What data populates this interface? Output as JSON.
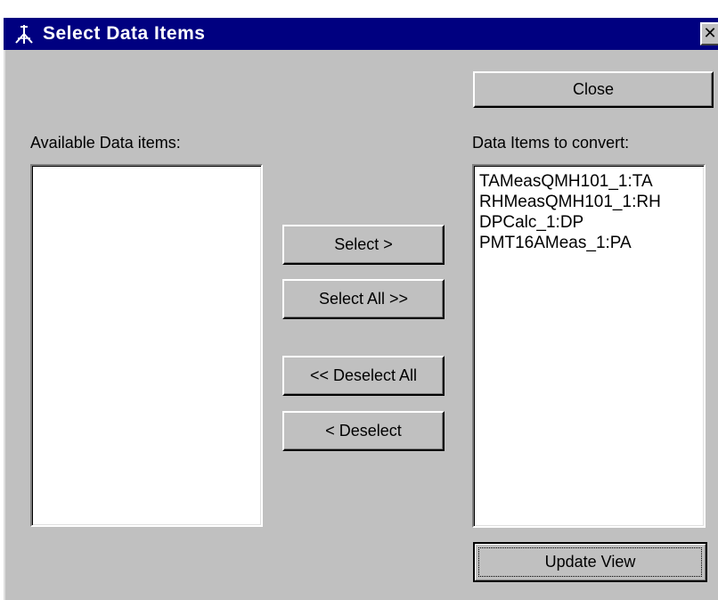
{
  "window": {
    "title": "Select Data Items",
    "close_glyph": "✕"
  },
  "available": {
    "label": "Available Data items:",
    "items": []
  },
  "selected": {
    "label": "Data Items to convert:",
    "items": [
      "TAMeasQMH101_1:TA",
      "RHMeasQMH101_1:RH",
      "DPCalc_1:DP",
      "PMT16AMeas_1:PA"
    ]
  },
  "buttons": {
    "close": "Close",
    "select": "Select >",
    "select_all": "Select All >>",
    "deselect_all": "<< Deselect All",
    "deselect": "< Deselect",
    "update_view": "Update View"
  },
  "colors": {
    "titlebar": "#000080",
    "face": "#c0c0c0",
    "list_bg": "#ffffff"
  },
  "icons": {
    "app": "tripod-tool-icon",
    "close": "close-icon"
  }
}
